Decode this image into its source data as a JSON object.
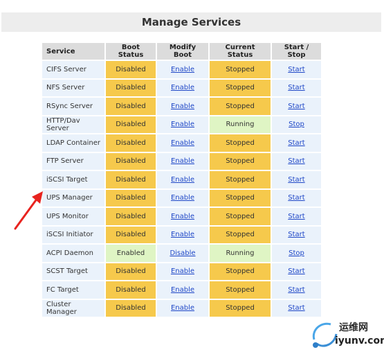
{
  "page": {
    "title": "Manage Services"
  },
  "table": {
    "headers": {
      "service": "Service",
      "boot_status": "Boot Status",
      "modify_boot": "Modify Boot",
      "current_status": "Current Status",
      "start_stop": "Start / Stop"
    },
    "rows": [
      {
        "service": "CIFS Server",
        "boot_status": "Disabled",
        "modify_boot": "Enable",
        "current_status": "Stopped",
        "action": "Start"
      },
      {
        "service": "NFS Server",
        "boot_status": "Disabled",
        "modify_boot": "Enable",
        "current_status": "Stopped",
        "action": "Start"
      },
      {
        "service": "RSync Server",
        "boot_status": "Disabled",
        "modify_boot": "Enable",
        "current_status": "Stopped",
        "action": "Start"
      },
      {
        "service": "HTTP/Dav Server",
        "boot_status": "Disabled",
        "modify_boot": "Enable",
        "current_status": "Running",
        "action": "Stop"
      },
      {
        "service": "LDAP Container",
        "boot_status": "Disabled",
        "modify_boot": "Enable",
        "current_status": "Stopped",
        "action": "Start"
      },
      {
        "service": "FTP Server",
        "boot_status": "Disabled",
        "modify_boot": "Enable",
        "current_status": "Stopped",
        "action": "Start"
      },
      {
        "service": "iSCSI Target",
        "boot_status": "Disabled",
        "modify_boot": "Enable",
        "current_status": "Stopped",
        "action": "Start"
      },
      {
        "service": "UPS Manager",
        "boot_status": "Disabled",
        "modify_boot": "Enable",
        "current_status": "Stopped",
        "action": "Start"
      },
      {
        "service": "UPS Monitor",
        "boot_status": "Disabled",
        "modify_boot": "Enable",
        "current_status": "Stopped",
        "action": "Start"
      },
      {
        "service": "iSCSI Initiator",
        "boot_status": "Disabled",
        "modify_boot": "Enable",
        "current_status": "Stopped",
        "action": "Start"
      },
      {
        "service": "ACPI Daemon",
        "boot_status": "Enabled",
        "modify_boot": "Disable",
        "current_status": "Running",
        "action": "Stop"
      },
      {
        "service": "SCST Target",
        "boot_status": "Disabled",
        "modify_boot": "Enable",
        "current_status": "Stopped",
        "action": "Start"
      },
      {
        "service": "FC Target",
        "boot_status": "Disabled",
        "modify_boot": "Enable",
        "current_status": "Stopped",
        "action": "Start"
      },
      {
        "service": "Cluster Manager",
        "boot_status": "Disabled",
        "modify_boot": "Enable",
        "current_status": "Stopped",
        "action": "Start"
      }
    ]
  },
  "annotation": {
    "arrow_color": "#e8231f",
    "points_to": "iSCSI Target"
  },
  "watermark": {
    "chinese": "运维网",
    "domain": "iyunv.com"
  },
  "colors": {
    "stopped_disabled": "#f6c94c",
    "running_enabled": "#dff5c4",
    "link": "#1f47c7",
    "name_cell": "#eaf2fb",
    "header": "#dcdcdc"
  }
}
